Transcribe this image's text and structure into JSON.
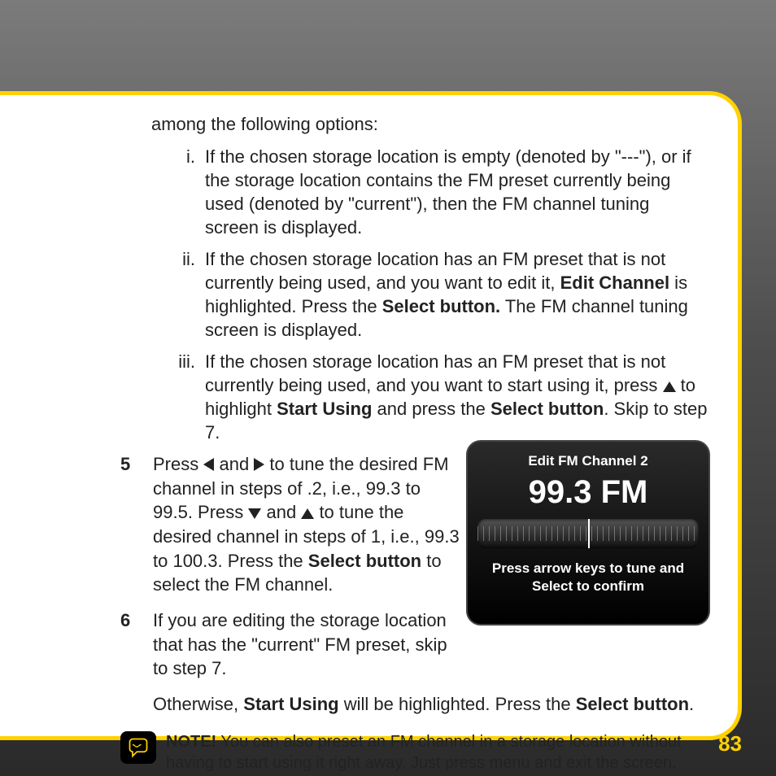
{
  "intro": "among the following options:",
  "roman": {
    "i_num": "i.",
    "i_text_a": "If the chosen storage location is empty (denoted by \"---\"), or if the storage location contains the FM preset currently being used (denoted by \"current\"), then the FM channel tuning screen is displayed.",
    "ii_num": "ii.",
    "ii_a": "If the chosen storage location has an FM preset that is not currently being used, and you want to edit it, ",
    "ii_b": "Edit Channel",
    "ii_c": " is highlighted. Press the ",
    "ii_d": "Select button.",
    "ii_e": " The FM channel tuning screen is displayed.",
    "iii_num": "iii.",
    "iii_a": "If the chosen storage location has an FM preset that is not currently being used, and you want to start using it, press ",
    "iii_b": " to highlight ",
    "iii_c": "Start Using",
    "iii_d": " and press the ",
    "iii_e": "Select button",
    "iii_f": ". Skip to step 7."
  },
  "step5": {
    "num": "5",
    "a": "Press ",
    "b": " and ",
    "c": " to tune the desired FM channel in steps of .2, i.e., 99.3 to 99.5. Press ",
    "d": " and ",
    "e": " to tune the desired channel in steps of 1, i.e., 99.3 to 100.3. Press the ",
    "f": "Select button",
    "g": " to select the FM channel."
  },
  "step6": {
    "num": "6",
    "a": "If you are editing the storage location that has the \"current\" FM preset, skip to step 7.",
    "b": "Otherwise, ",
    "c": "Start Using",
    "d": " will be highlighted. Press the ",
    "e": "Select button",
    "f": "."
  },
  "note": {
    "label": "NOTE!",
    "text": " You can also preset an FM channel in a storage location without having to start using it right away. Just press menu and exit the screen."
  },
  "radio": {
    "title": "Edit FM Channel 2",
    "freq": "99.3 FM",
    "hint": "Press arrow keys to tune and Select to confirm"
  },
  "page_number": "83"
}
